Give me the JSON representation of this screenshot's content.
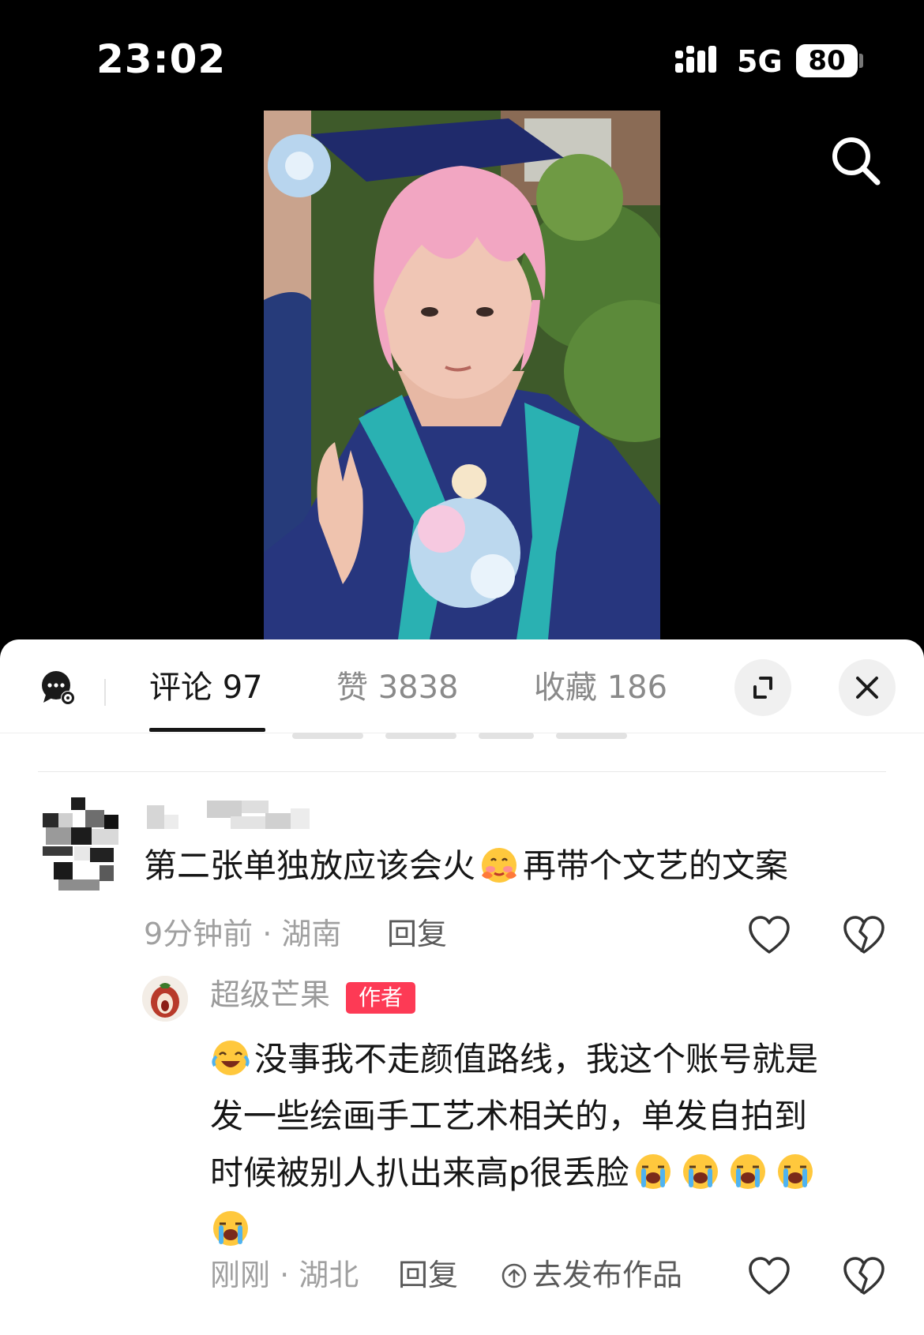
{
  "status_bar": {
    "time": "23:02",
    "network": "5G",
    "battery": "80"
  },
  "tabs": [
    {
      "label": "评论 97"
    },
    {
      "label": "赞 3838"
    },
    {
      "label": "收藏 186"
    }
  ],
  "comment": {
    "text_part1": "第二张单独放应该会火",
    "text_part2": "再带个文艺的文案",
    "meta": "9分钟前 · 湖南",
    "reply_label": "回复"
  },
  "reply": {
    "author": "超级芒果",
    "author_tag": "作者",
    "lines": [
      "没事我不走颜值路线，我这个账号就是",
      "发一些绘画手工艺术相关的，单发自拍到",
      "时候被别人扒出来高p很丢脸"
    ],
    "meta": "刚刚 · 湖北",
    "reply_label": "回复",
    "publish_label": "去发布作品"
  },
  "icons": {
    "search": "search-icon",
    "chat_settings": "chat-settings-icon",
    "expand": "expand-icon",
    "close": "close-icon",
    "like": "heart-icon",
    "dislike": "broken-heart-icon",
    "emoji_blush": "shy-emoji",
    "emoji_laugh_cry": "laugh-cry-emoji",
    "emoji_cry": "loud-cry-emoji",
    "upload": "upload-circle-icon"
  },
  "colors": {
    "author_tag": "#fd3a55",
    "text": "#161616",
    "muted": "#a0a0a0"
  }
}
